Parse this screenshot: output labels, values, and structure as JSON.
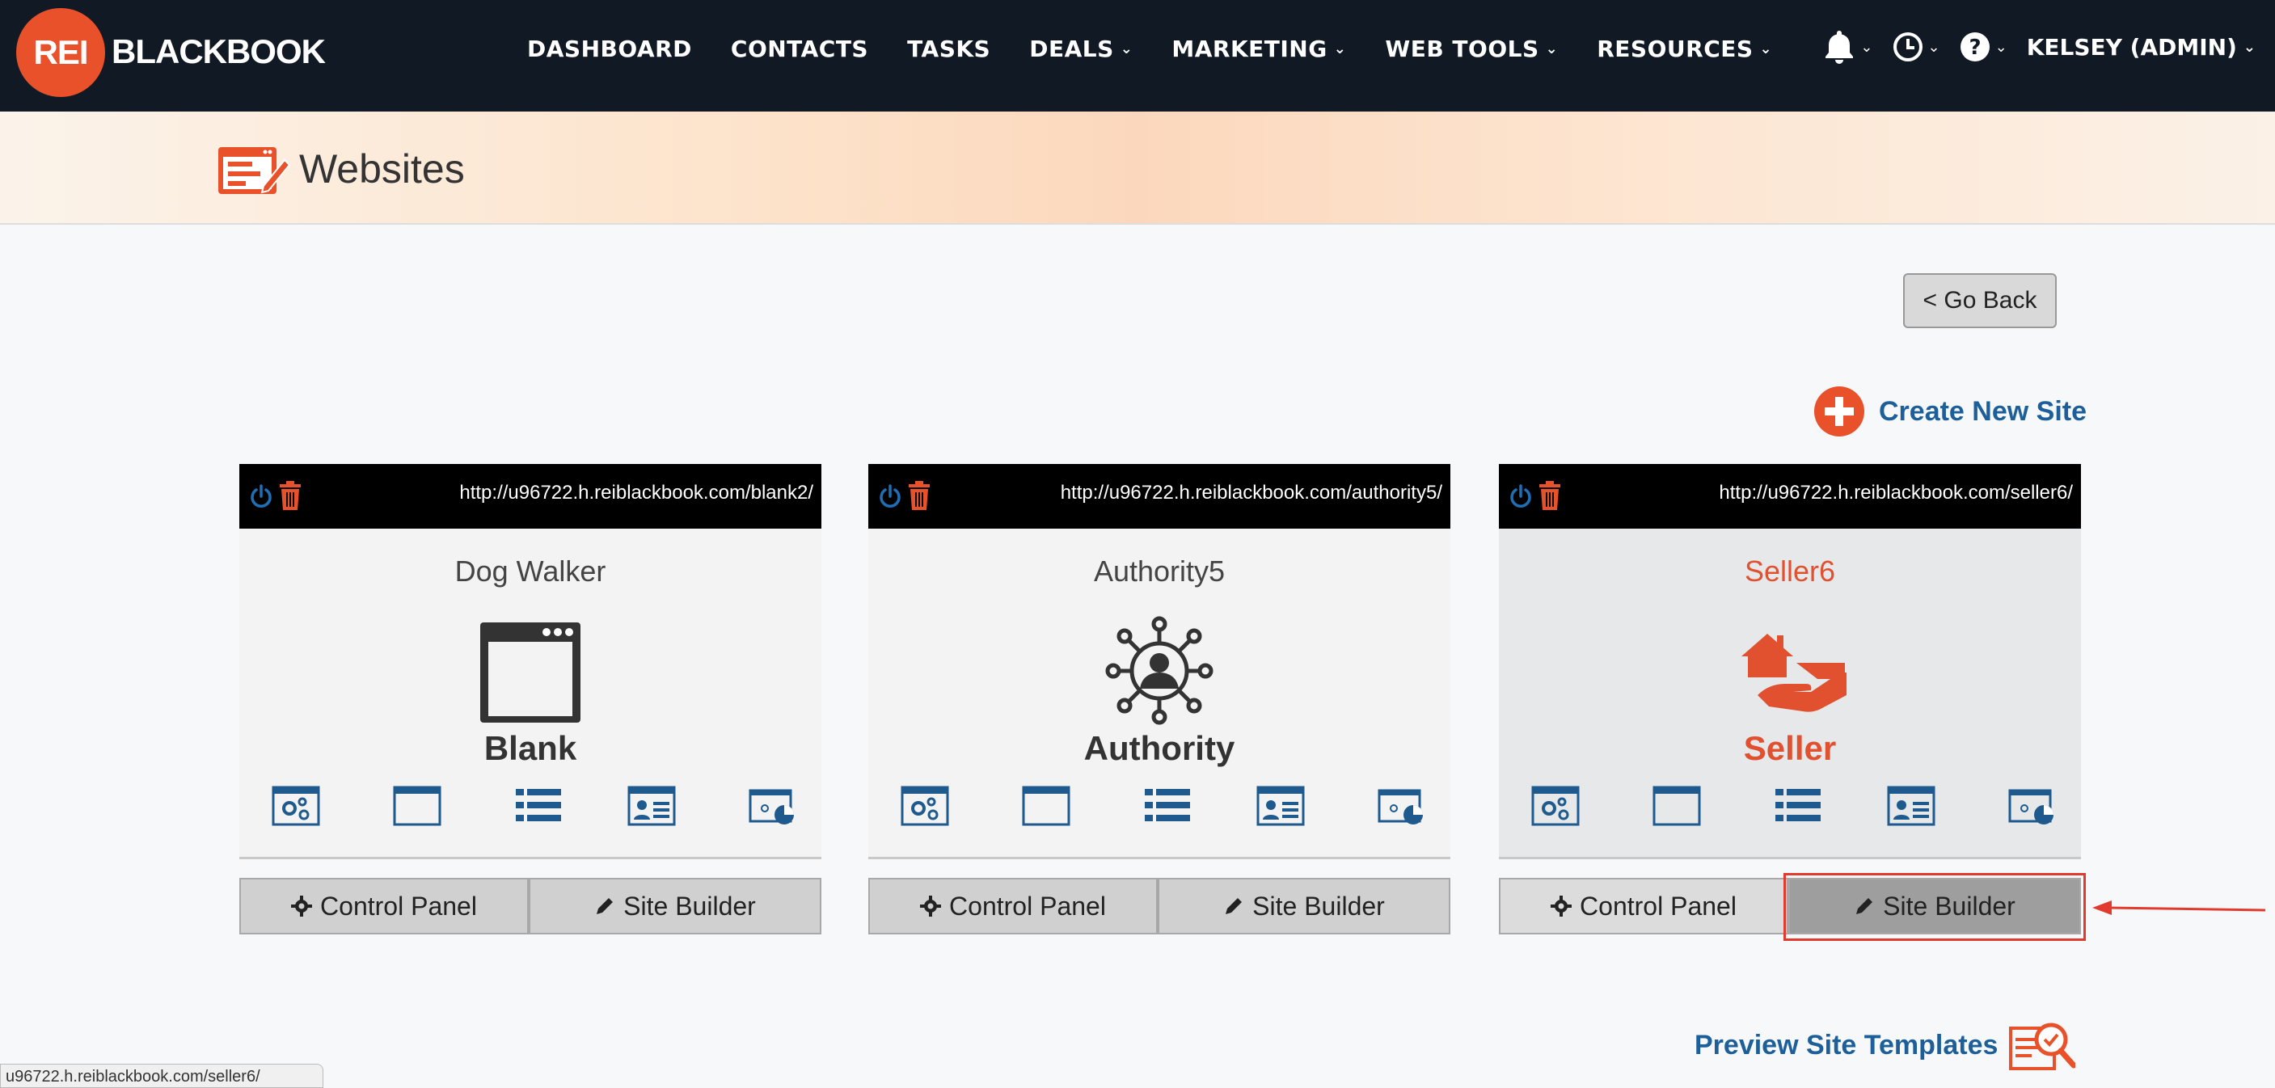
{
  "app": {
    "logo_mark": "REI",
    "logo_text": "BLACKBOOK"
  },
  "nav": {
    "items": [
      {
        "label": "DASHBOARD",
        "dropdown": false
      },
      {
        "label": "CONTACTS",
        "dropdown": false
      },
      {
        "label": "TASKS",
        "dropdown": false
      },
      {
        "label": "DEALS",
        "dropdown": true
      },
      {
        "label": "MARKETING",
        "dropdown": true
      },
      {
        "label": "WEB TOOLS",
        "dropdown": true
      },
      {
        "label": "RESOURCES",
        "dropdown": true
      }
    ],
    "right_icons": [
      "bell-icon",
      "clock-icon",
      "help-icon"
    ],
    "user": "KELSEY (ADMIN)",
    "caret": "⌄"
  },
  "page": {
    "title": "Websites",
    "icon": "website-edit-icon"
  },
  "actions": {
    "go_back": "< Go Back",
    "create_new": "Create New Site",
    "preview_templates": "Preview Site Templates"
  },
  "cards": [
    {
      "url": "http://u96722.h.reiblackbook.com/blank2/",
      "site_name": "Dog Walker",
      "template": "Blank",
      "template_icon": "browser-window-icon",
      "control_panel": "Control Panel",
      "site_builder": "Site Builder",
      "selected": false
    },
    {
      "url": "http://u96722.h.reiblackbook.com/authority5/",
      "site_name": "Authority5",
      "template": "Authority",
      "template_icon": "network-person-icon",
      "control_panel": "Control Panel",
      "site_builder": "Site Builder",
      "selected": false
    },
    {
      "url": "http://u96722.h.reiblackbook.com/seller6/",
      "site_name": "Seller6",
      "template": "Seller",
      "template_icon": "house-hand-icon",
      "control_panel": "Control Panel",
      "site_builder": "Site Builder",
      "selected": true
    }
  ],
  "tool_icons": [
    "site-settings-icon",
    "page-icon",
    "list-icon",
    "contact-card-icon",
    "analytics-icon"
  ],
  "status_bar": "u96722.h.reiblackbook.com/seller6/",
  "colors": {
    "nav_bg": "#111a24",
    "brand_orange": "#e8512a",
    "link_blue": "#1c5f99",
    "tool_blue": "#1e5a8e",
    "highlight_red": "#e23b2e"
  }
}
